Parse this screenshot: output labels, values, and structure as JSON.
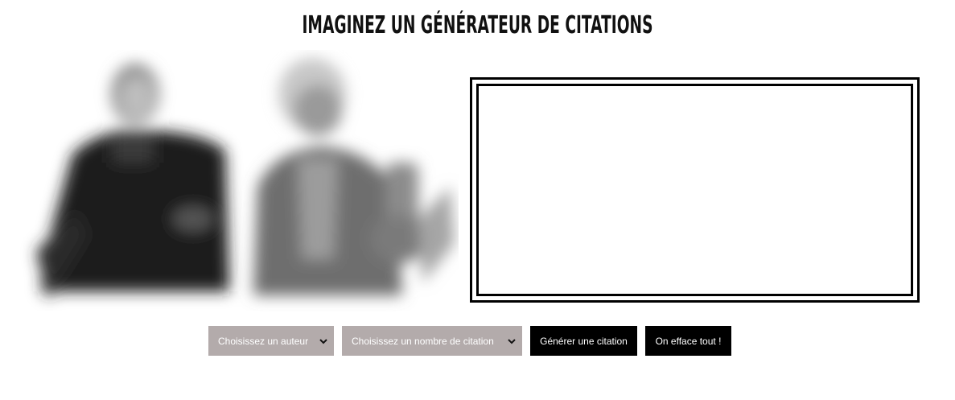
{
  "header": {
    "title": "IMAGINEZ UN GÉNÉRATEUR DE CITATIONS"
  },
  "quote": {
    "text": ""
  },
  "controls": {
    "author_select": {
      "value": "Choisissez un auteur",
      "icon": "chevron-down-icon"
    },
    "count_select": {
      "value": "Choisissez un nombre de citation",
      "icon": "chevron-down-icon"
    },
    "generate_label": "Générer une citation",
    "clear_label": "On efface tout !"
  },
  "colors": {
    "select_bg": "#b3abab",
    "button_bg": "#000000",
    "frame_border": "#000000"
  }
}
